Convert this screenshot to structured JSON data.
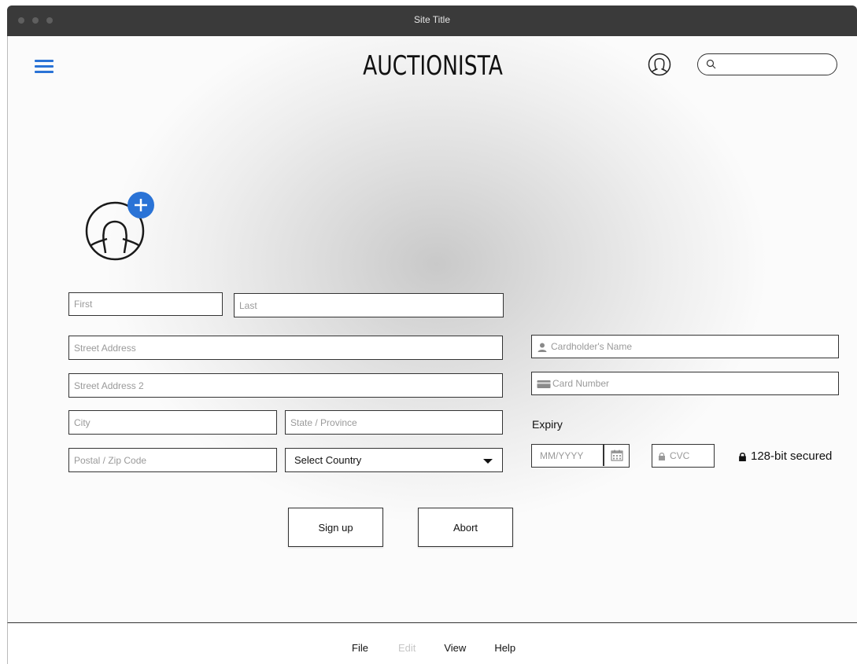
{
  "window": {
    "title": "Site Title"
  },
  "header": {
    "brand": "AUCTIONISTA",
    "search_placeholder": ""
  },
  "form": {
    "first_placeholder": "First",
    "last_placeholder": "Last",
    "street_placeholder": "Street Address",
    "street2_placeholder": "Street Address 2",
    "city_placeholder": "City",
    "state_placeholder": "State / Province",
    "postal_placeholder": "Postal / Zip Code",
    "country_selected": "Select Country"
  },
  "payment": {
    "cardholder_placeholder": "Cardholder's Name",
    "card_number_placeholder": "Card Number",
    "expiry_label": "Expiry",
    "expiry_placeholder": "MM/YYYY",
    "cvc_placeholder": "CVC",
    "secured_text": "128-bit secured"
  },
  "buttons": {
    "signup": "Sign up",
    "abort": "Abort"
  },
  "menu": [
    {
      "label": "File",
      "enabled": true
    },
    {
      "label": "Edit",
      "enabled": false
    },
    {
      "label": "View",
      "enabled": true
    },
    {
      "label": "Help",
      "enabled": true
    }
  ],
  "colors": {
    "accent": "#2a73d6",
    "titlebar": "#3a3a3a"
  }
}
